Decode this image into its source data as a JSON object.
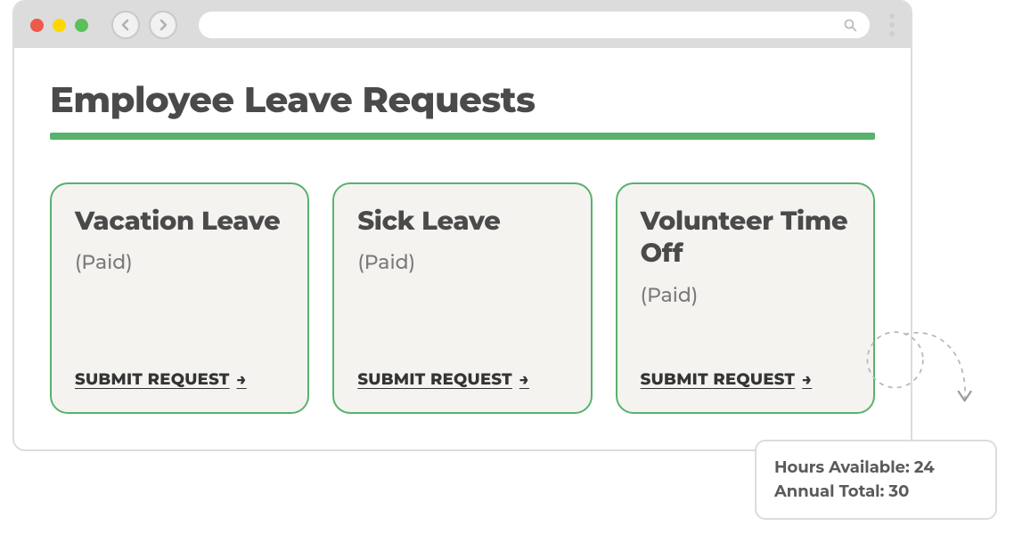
{
  "page": {
    "title": "Employee Leave Requests"
  },
  "cards": [
    {
      "title": "Vacation Leave",
      "subtitle": "(Paid)",
      "action": "SUBMIT REQUEST"
    },
    {
      "title": "Sick Leave",
      "subtitle": "(Paid)",
      "action": "SUBMIT REQUEST"
    },
    {
      "title": "Volunteer Time Off",
      "subtitle": "(Paid)",
      "action": "SUBMIT REQUEST"
    }
  ],
  "tooltip": {
    "line1": "Hours Available: 24",
    "line2": "Annual Total: 30"
  }
}
